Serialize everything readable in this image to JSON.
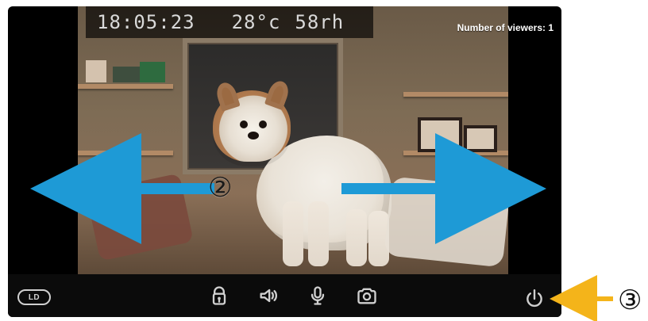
{
  "overlay": {
    "time": "18:05:23",
    "temperature": "28°c",
    "humidity": "58rh",
    "viewers": "Number of viewers: 1"
  },
  "controls": {
    "ld_label": "LD",
    "lock_icon": "lock-icon",
    "speaker_icon": "speaker-icon",
    "mic_icon": "microphone-icon",
    "camera_icon": "camera-icon",
    "power_icon": "power-icon"
  },
  "annotations": {
    "marker_2": "②",
    "marker_3": "③",
    "blue_arrow_color": "#1e9ad6",
    "orange_arrow_color": "#f4b41a"
  }
}
